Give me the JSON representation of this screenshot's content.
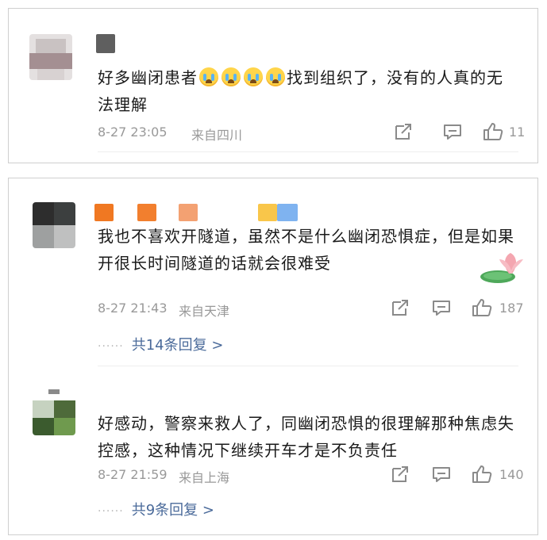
{
  "comments": [
    {
      "text_before": "好多幽闭患者",
      "emoji_count": 4,
      "text_after": "找到组织了，没有的人真的无法理解",
      "time": "8-27 23:05",
      "location": "来自四川",
      "likes": "11"
    },
    {
      "text": "我也不喜欢开隧道，虽然不是什么幽闭恐惧症，但是如果开很长时间隧道的话就会很难受",
      "time": "8-27 21:43",
      "location": "来自天津",
      "likes": "187",
      "replies": "共14条回复 >"
    },
    {
      "text": "好感动，警察来救人了，同幽闭恐惧的很理解那种焦虑失控感，这种情况下继续开车才是不负责任",
      "time": "8-27 21:59",
      "location": "来自上海",
      "likes": "140",
      "replies": "共9条回复 >"
    }
  ],
  "ui": {
    "reply_dots": "······",
    "icons": [
      "share-icon",
      "comment-icon",
      "like-icon"
    ]
  },
  "colors": {
    "meta_gray": "#999999",
    "link_blue": "#4a6a9a",
    "card_border": "#cfcfcf"
  }
}
